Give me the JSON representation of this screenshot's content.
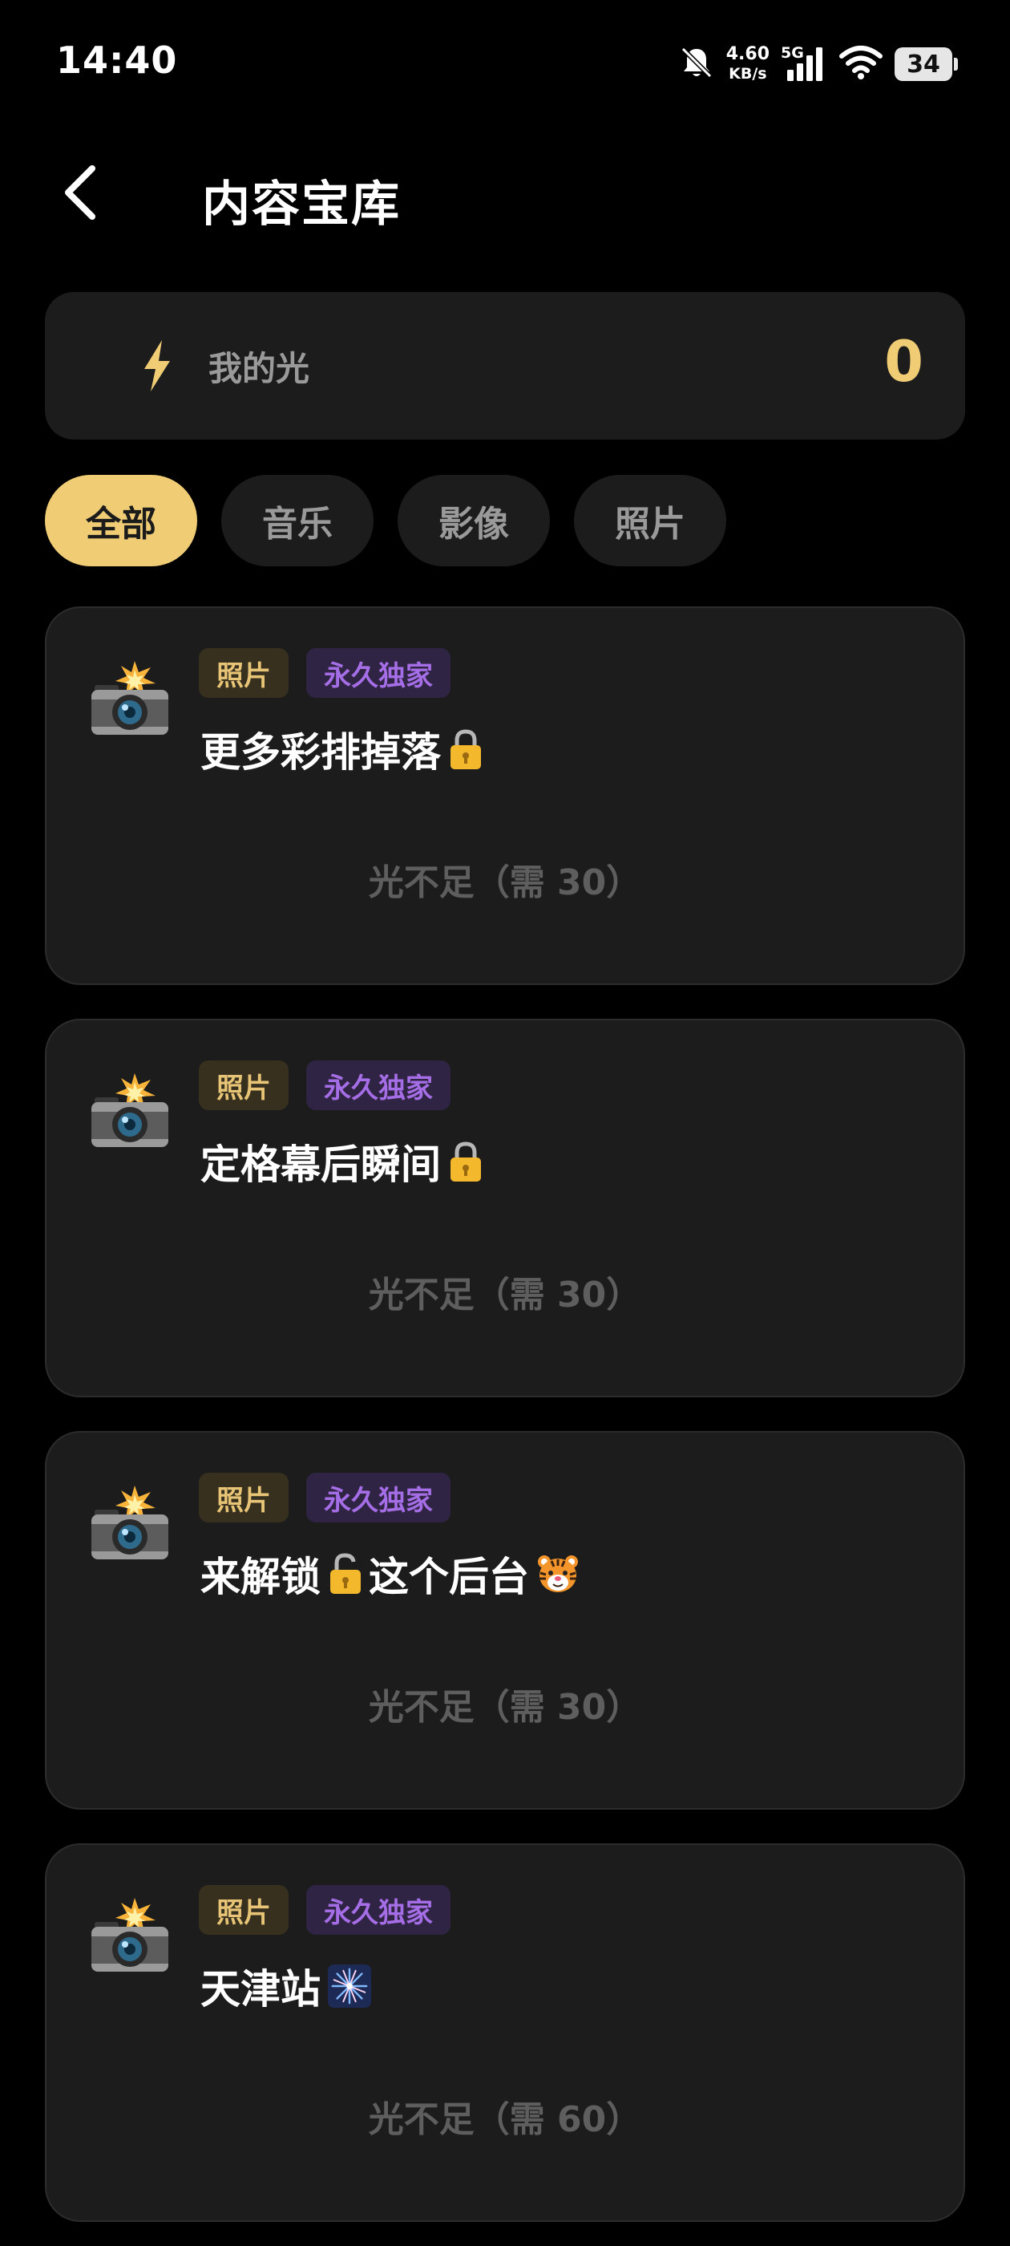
{
  "status_bar": {
    "time": "14:40",
    "net_speed_value": "4.60",
    "net_speed_unit": "KB/s",
    "network_type": "5G",
    "battery_level": "34",
    "icons": [
      "bell-off-icon",
      "cell-signal-icon",
      "wifi-icon",
      "battery-icon"
    ]
  },
  "header": {
    "title": "内容宝库"
  },
  "light": {
    "label": "我的光",
    "value": "0",
    "icon": "lightning-bolt-icon",
    "accent_color": "#f0cd75"
  },
  "tabs": [
    {
      "label": "全部",
      "active": true
    },
    {
      "label": "音乐",
      "active": false
    },
    {
      "label": "影像",
      "active": false
    },
    {
      "label": "照片",
      "active": false
    }
  ],
  "cards": [
    {
      "icon": "camera-flash-icon",
      "tag_type": "照片",
      "tag_exclusive": "永久独家",
      "title": "更多彩排掉落",
      "title_emoji": "lock-icon",
      "status": "光不足（需 30）"
    },
    {
      "icon": "camera-flash-icon",
      "tag_type": "照片",
      "tag_exclusive": "永久独家",
      "title": "定格幕后瞬间",
      "title_emoji": "lock-icon",
      "status": "光不足（需 30）"
    },
    {
      "icon": "camera-flash-icon",
      "tag_type": "照片",
      "tag_exclusive": "永久独家",
      "title_prefix": "来解锁",
      "title_middle_emoji": "unlocked-lock-icon",
      "title_suffix": "这个后台",
      "title_emoji": "tiger-face-icon",
      "status": "光不足（需 30）"
    },
    {
      "icon": "camera-flash-icon",
      "tag_type": "照片",
      "tag_exclusive": "永久独家",
      "title": "天津站",
      "title_emoji": "fireworks-icon",
      "status": "光不足（需 60）"
    }
  ]
}
